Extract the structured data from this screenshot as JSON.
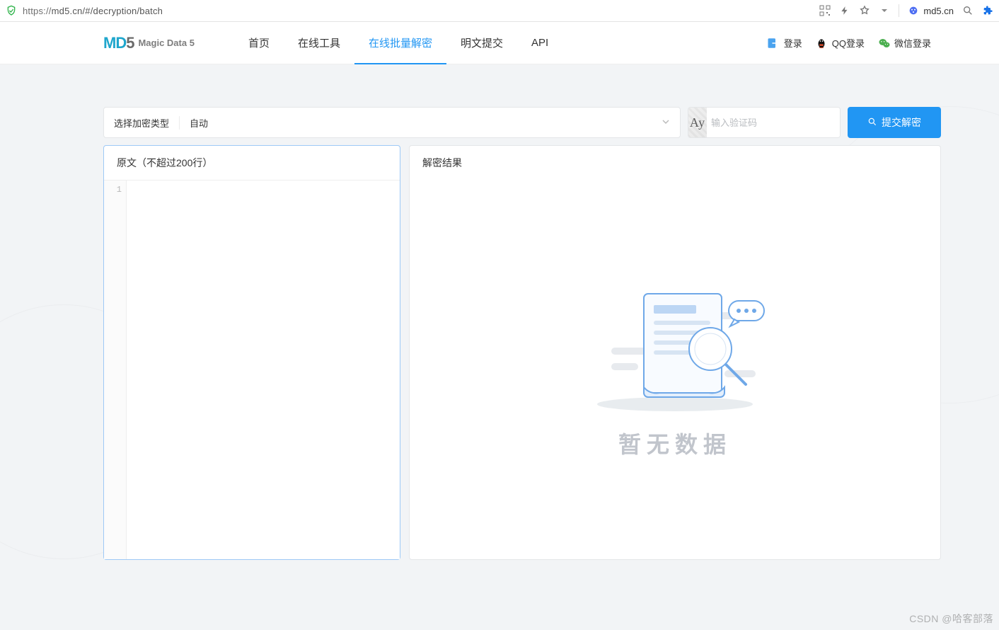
{
  "browser": {
    "url_proto": "https://",
    "url_rest": "md5.cn/#/decryption/batch",
    "site_chip": "md5.cn"
  },
  "logo": {
    "text": "Magic Data 5"
  },
  "nav": {
    "items": [
      "首页",
      "在线工具",
      "在线批量解密",
      "明文提交",
      "API"
    ],
    "active_index": 2
  },
  "logins": {
    "login": "登录",
    "qq": "QQ登录",
    "wechat": "微信登录"
  },
  "toolbar": {
    "select_label": "选择加密类型",
    "select_value": "自动",
    "captcha_placeholder": "输入验证码",
    "captcha_text": "Ay",
    "submit_label": "提交解密"
  },
  "panels": {
    "left_title": "原文（不超过200行）",
    "right_title": "解密结果",
    "gutter_line": "1",
    "empty_text": "暂无数据"
  },
  "watermark": "CSDN @哈客部落"
}
